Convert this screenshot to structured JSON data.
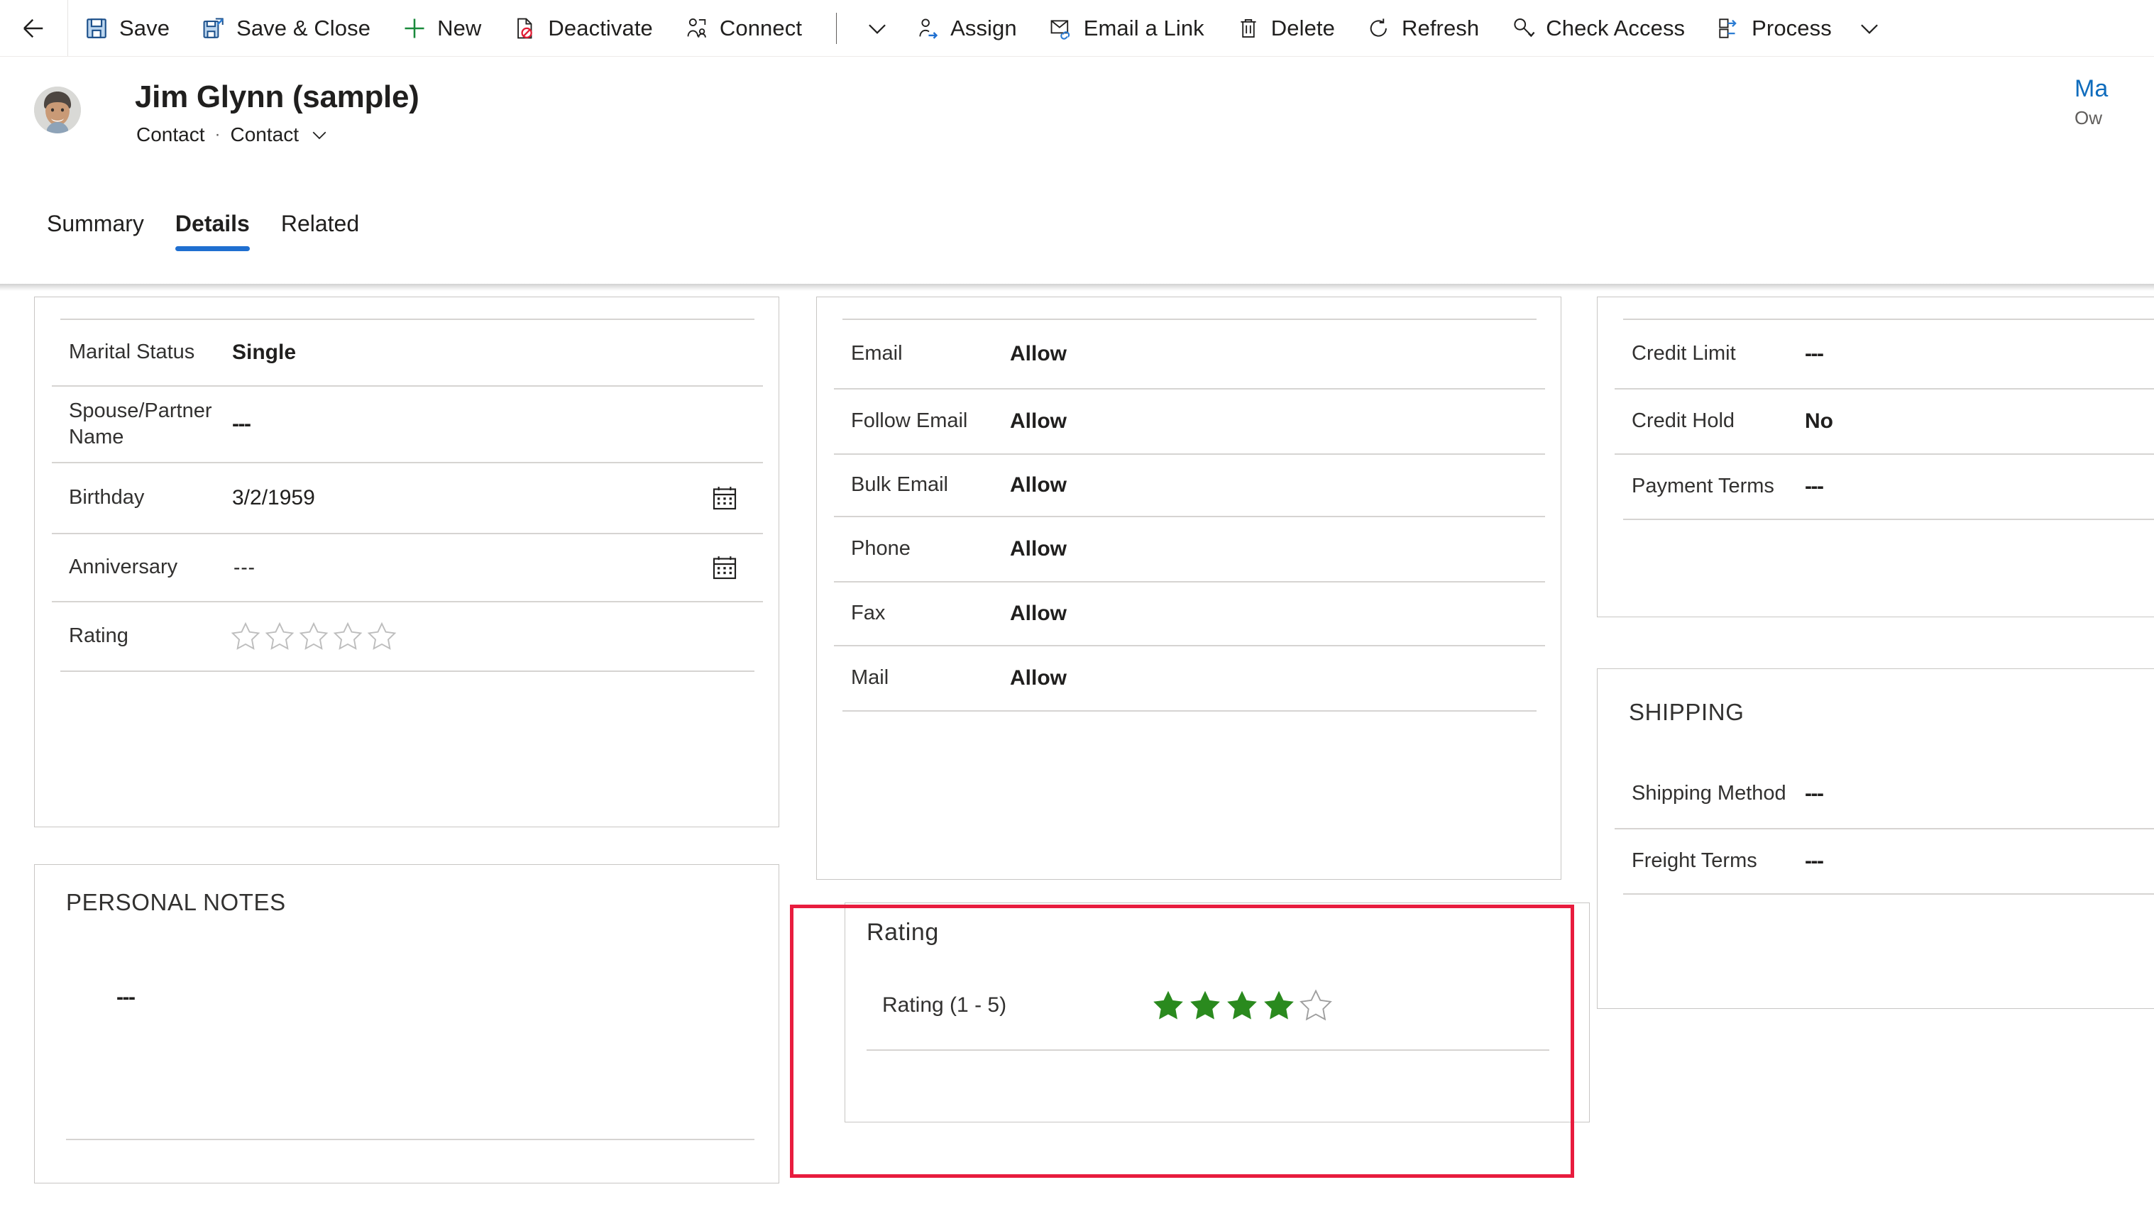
{
  "commandbar": {
    "back_label": "Back",
    "items": [
      {
        "label": "Save",
        "icon": "save-icon"
      },
      {
        "label": "Save & Close",
        "icon": "save-and-close-icon"
      },
      {
        "label": "New",
        "icon": "plus-icon"
      },
      {
        "label": "Deactivate",
        "icon": "deactivate-icon"
      },
      {
        "label": "Connect",
        "icon": "connect-icon"
      }
    ],
    "items2": [
      {
        "label": "Assign",
        "icon": "assign-icon"
      },
      {
        "label": "Email a Link",
        "icon": "email-link-icon"
      },
      {
        "label": "Delete",
        "icon": "trash-icon"
      },
      {
        "label": "Refresh",
        "icon": "refresh-icon"
      },
      {
        "label": "Check Access",
        "icon": "check-access-icon"
      },
      {
        "label": "Process",
        "icon": "process-icon"
      }
    ]
  },
  "header": {
    "title": "Jim Glynn (sample)",
    "subtype": "Contact",
    "separator": "·",
    "form_name": "Contact",
    "right_value": "Ma",
    "right_label": "Ow"
  },
  "tabs": [
    {
      "label": "Summary",
      "active": false
    },
    {
      "label": "Details",
      "active": true
    },
    {
      "label": "Related",
      "active": false
    }
  ],
  "personal": {
    "rows": [
      {
        "label": "Marital Status",
        "value": "Single",
        "kind": "text"
      },
      {
        "label": "Spouse/Partner Name",
        "value": "---",
        "kind": "dash"
      },
      {
        "label": "Birthday",
        "value": "3/2/1959",
        "kind": "date"
      },
      {
        "label": "Anniversary",
        "value": "---",
        "kind": "date-dash"
      },
      {
        "label": "Rating",
        "value": "",
        "kind": "stars",
        "stars_filled": 0,
        "stars_total": 5
      }
    ]
  },
  "personal_notes": {
    "title": "PERSONAL NOTES",
    "value": "---"
  },
  "contact_prefs": {
    "rows": [
      {
        "label": "Email",
        "value": "Allow"
      },
      {
        "label": "Follow Email",
        "value": "Allow"
      },
      {
        "label": "Bulk Email",
        "value": "Allow"
      },
      {
        "label": "Phone",
        "value": "Allow"
      },
      {
        "label": "Fax",
        "value": "Allow"
      },
      {
        "label": "Mail",
        "value": "Allow"
      }
    ]
  },
  "rating_section": {
    "title": "Rating",
    "field_label": "Rating (1 - 5)",
    "stars_filled": 4,
    "stars_total": 5,
    "star_color": "#2a8a1e",
    "highlight_color": "#e81c3e"
  },
  "billing": {
    "rows": [
      {
        "label": "Credit Limit",
        "value": "---"
      },
      {
        "label": "Credit Hold",
        "value": "No"
      },
      {
        "label": "Payment Terms",
        "value": "---"
      }
    ]
  },
  "shipping": {
    "title": "SHIPPING",
    "rows": [
      {
        "label": "Shipping Method",
        "value": "---"
      },
      {
        "label": "Freight Terms",
        "value": "---"
      }
    ]
  }
}
